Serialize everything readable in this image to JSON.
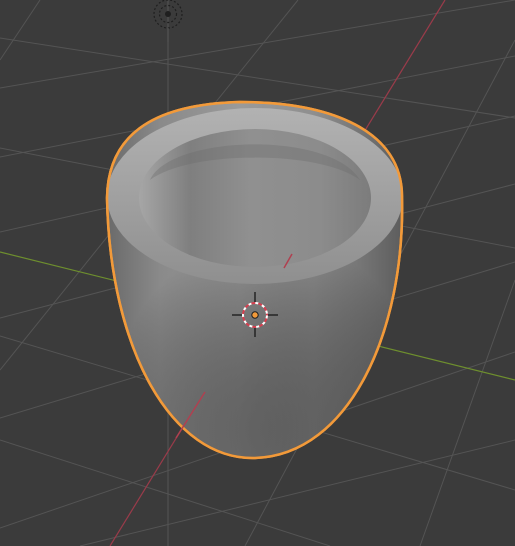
{
  "viewport": {
    "background": "#3b3b3b",
    "grid_color": "#545454",
    "x_axis_color": "#9a3b4a",
    "y_axis_color": "#6e8f2e",
    "selection_outline_color": "#f29a3a"
  },
  "scene": {
    "selected_object_icon": "cup-mesh",
    "origin_icon": "object-origin-icon",
    "cursor_icon": "3d-cursor-icon",
    "camera_icon": "camera-icon"
  }
}
